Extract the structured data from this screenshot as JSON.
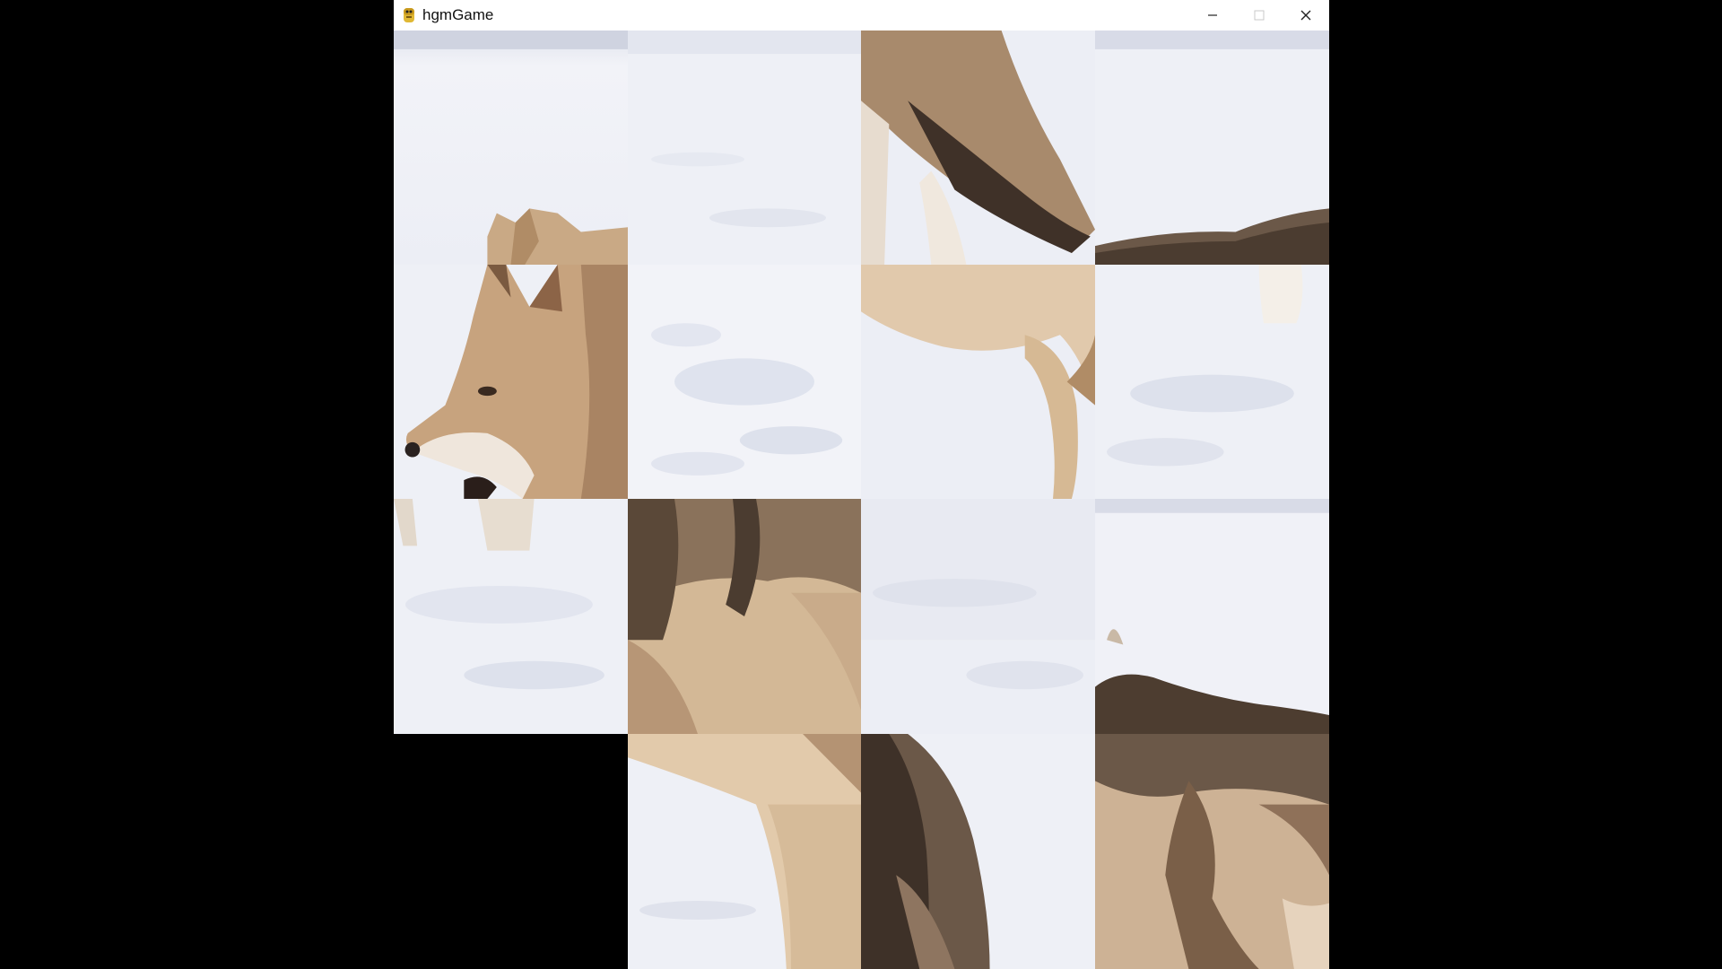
{
  "window": {
    "title": "hgmGame",
    "controls": [
      "minimize",
      "maximize",
      "close"
    ]
  },
  "game": {
    "type": "sliding-puzzle",
    "grid": {
      "rows": 4,
      "cols": 4
    },
    "image_subject": "wolf in snow",
    "empty_tile": {
      "row": 4,
      "col": 1
    },
    "tiles": [
      {
        "row": 1,
        "col": 1,
        "content": "snow-and-wolf-ears"
      },
      {
        "row": 1,
        "col": 2,
        "content": "snow"
      },
      {
        "row": 1,
        "col": 3,
        "content": "wolf-tail"
      },
      {
        "row": 1,
        "col": 4,
        "content": "snow-and-wolf-back"
      },
      {
        "row": 2,
        "col": 1,
        "content": "wolf-head"
      },
      {
        "row": 2,
        "col": 2,
        "content": "snow-tracks"
      },
      {
        "row": 2,
        "col": 3,
        "content": "wolf-leg"
      },
      {
        "row": 2,
        "col": 4,
        "content": "snow-and-wolf-paw"
      },
      {
        "row": 3,
        "col": 1,
        "content": "snow-with-legs"
      },
      {
        "row": 3,
        "col": 2,
        "content": "wolf-shoulder"
      },
      {
        "row": 3,
        "col": 3,
        "content": "snow"
      },
      {
        "row": 3,
        "col": 4,
        "content": "snow-and-wolf-back"
      },
      {
        "row": 4,
        "col": 1,
        "content": "empty"
      },
      {
        "row": 4,
        "col": 2,
        "content": "wolf-front-leg"
      },
      {
        "row": 4,
        "col": 3,
        "content": "snow-and-wolf-fur"
      },
      {
        "row": 4,
        "col": 4,
        "content": "wolf-body-fur"
      }
    ]
  },
  "colors": {
    "snow": "#eef0f6",
    "snow_shadow": "#d9dde9",
    "fur_light": "#d8c0a2",
    "fur_mid": "#b08c66",
    "fur_dark": "#4d3d30",
    "empty": "#000000"
  }
}
